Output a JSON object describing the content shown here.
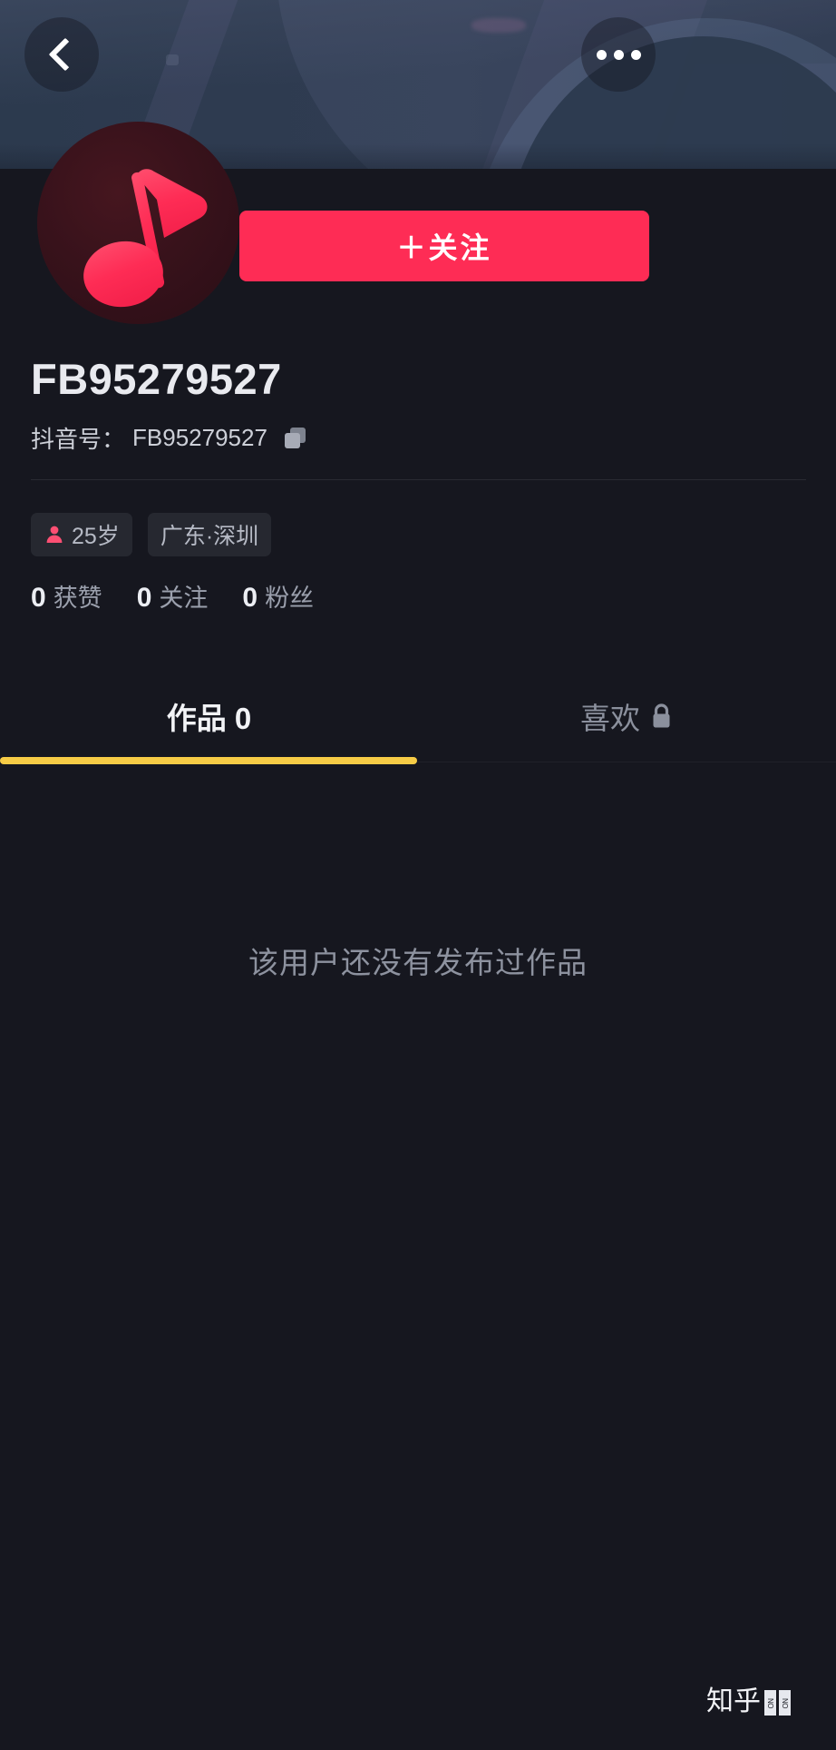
{
  "header": {
    "back_icon": "chevron-left-icon",
    "more_icon": "more-horizontal-icon",
    "banner_color": "#2c3a4e"
  },
  "profile": {
    "avatar_icon": "music-note-icon",
    "avatar_bg": "#38121b",
    "avatar_note_color": "#fe2c55",
    "follow_button": "＋关注",
    "follow_button_color": "#fe2c55",
    "username": "FB95279527",
    "id_label": "抖音号：",
    "id_value": "FB95279527",
    "copy_icon": "copy-icon"
  },
  "tags": [
    {
      "icon": "person-icon",
      "label": "25岁",
      "icon_color": "#fe4f73"
    },
    {
      "icon": "",
      "label": "广东·深圳",
      "icon_color": ""
    }
  ],
  "stats": [
    {
      "count": "0",
      "label": "获赞"
    },
    {
      "count": "0",
      "label": "关注"
    },
    {
      "count": "0",
      "label": "粉丝"
    }
  ],
  "tabs": [
    {
      "label": "作品 0",
      "active": true,
      "icon": ""
    },
    {
      "label": "喜欢",
      "active": false,
      "icon": "lock-icon"
    }
  ],
  "tab_indicator_color": "#f7cc46",
  "empty_state": {
    "message": "该用户还没有发布过作品"
  },
  "watermark": {
    "text": "知乎",
    "handle_1": "NO G4YH",
    "handle_2": "NO G4YH"
  }
}
